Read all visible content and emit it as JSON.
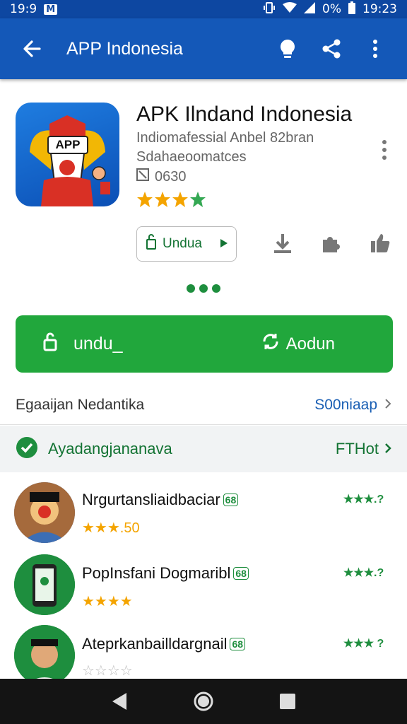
{
  "status_bar": {
    "time": "19:9",
    "badge": "M",
    "battery_text": "0%",
    "clock_right": "19:23"
  },
  "app_bar": {
    "title": "APP Indonesia",
    "icons": [
      "back-arrow-icon",
      "lightbulb-icon",
      "share-icon",
      "more-vert-icon"
    ]
  },
  "app": {
    "logo_text": "APP",
    "title": "APK Ilndand Indonesia",
    "subtitle1": "Indiomafessial Anbel 82bran",
    "subtitle2": "Sdahaeoomatces",
    "size": "0630",
    "rating_stars": 4,
    "download_label": "Undua",
    "mini_icons": [
      "download-icon",
      "puzzle-icon",
      "thumbs-up-icon"
    ]
  },
  "primary_action": {
    "install_label": "undu_",
    "open_label": "Aodun"
  },
  "info_row": {
    "label": "Egaaijan Nedantika",
    "link": "S00niaap"
  },
  "section": {
    "label": "Ayadangjananava",
    "link": "FTHot"
  },
  "list": [
    {
      "title": "Nrgurtansliaidbaciar",
      "tag": "68",
      "stars_text": "★★★.50",
      "rating_text": "★★★.?"
    },
    {
      "title": "PopInsfani Dogmaribl",
      "tag": "68",
      "stars_text": "★★★★",
      "rating_text": "★★★.?"
    },
    {
      "title": "Ateprkanbailldargnail",
      "tag": "68",
      "stars_text": "☆☆☆☆",
      "rating_text": "★★★ ?"
    }
  ],
  "colors": {
    "app_bar": "#1458b8",
    "accent_green": "#21a73c",
    "star_yellow": "#f4a400"
  }
}
